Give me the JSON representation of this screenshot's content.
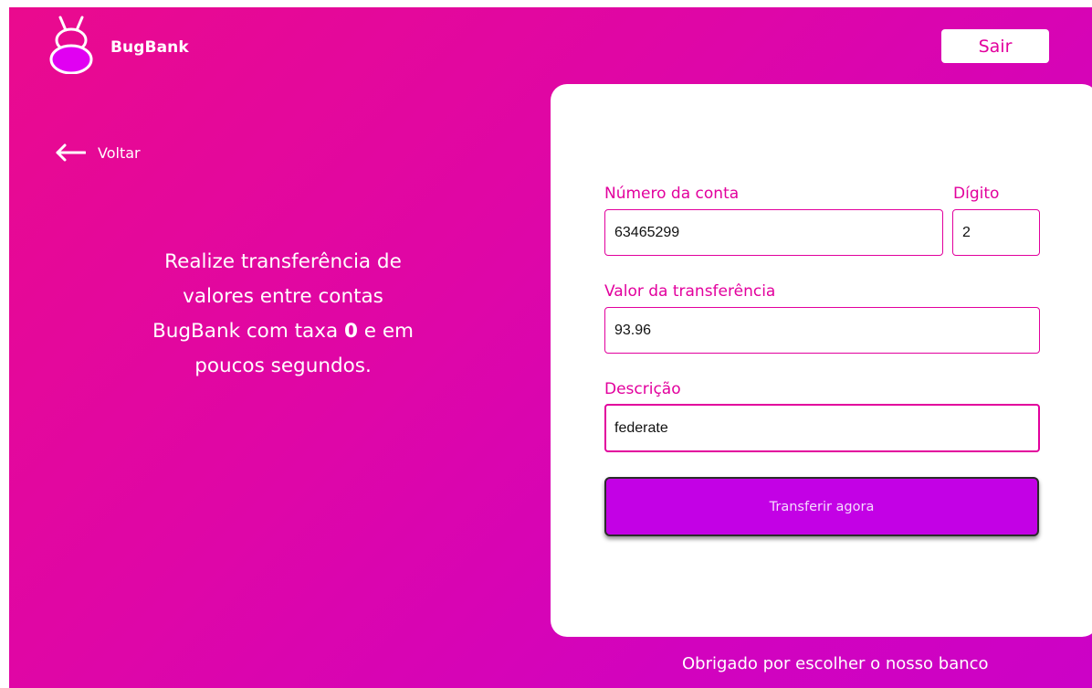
{
  "header": {
    "brand": "BugBank",
    "logout_label": "Sair",
    "logo_icon": "bug-logo-icon"
  },
  "nav": {
    "back_label": "Voltar",
    "back_icon": "arrow-left-icon"
  },
  "promo": {
    "line1": "Realize transferência de",
    "line2": "valores entre contas",
    "line3_prefix": "BugBank com taxa ",
    "line3_bold": "0",
    "line3_suffix": " e em",
    "line4": "poucos segundos."
  },
  "form": {
    "account_number_label": "Número da conta",
    "account_number_value": "63465299",
    "digit_label": "Dígito",
    "digit_value": "2",
    "amount_label": "Valor da transferência",
    "amount_value": "93.96",
    "description_label": "Descrição",
    "description_value": "federate",
    "submit_label": "Transferir agora"
  },
  "footer": {
    "text": "Obrigado por escolher o nosso banco"
  },
  "colors": {
    "accent": "#e2009d",
    "button": "#c301e5",
    "gradient_start": "#ea0a8e",
    "gradient_end": "#cc02c6"
  }
}
